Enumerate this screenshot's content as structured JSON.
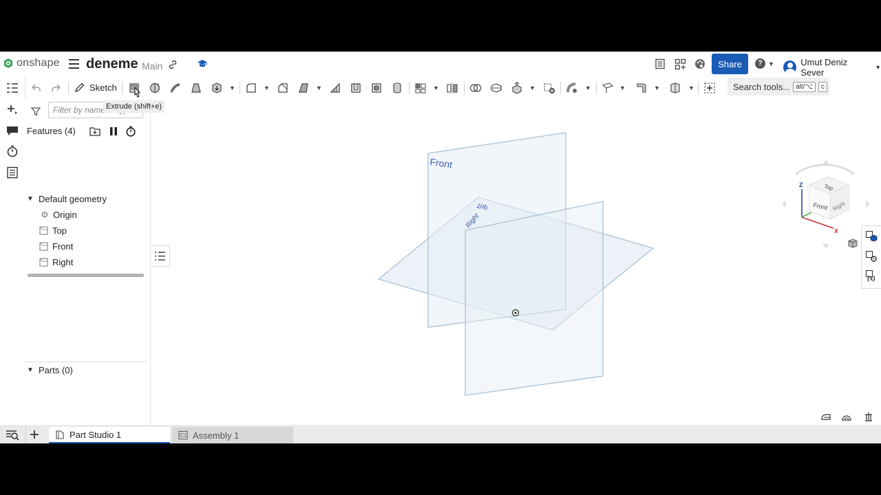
{
  "header": {
    "logo_text": "onshape",
    "doc_name": "deneme",
    "branch": "Main",
    "share_label": "Share",
    "help_label": "?",
    "user_name": "Umut Deniz Sever"
  },
  "toolbar": {
    "sketch_label": "Sketch",
    "search_label": "Search tools...",
    "search_key_1": "alt/⌥",
    "search_key_2": "c",
    "tooltip": "Extrude (shift+e)"
  },
  "panel": {
    "filter_placeholder": "Filter by name or type",
    "features_title": "Features (4)",
    "default_geometry": "Default geometry",
    "items": [
      {
        "label": "Origin"
      },
      {
        "label": "Top"
      },
      {
        "label": "Front"
      },
      {
        "label": "Right"
      }
    ],
    "parts_title": "Parts (0)"
  },
  "viewport": {
    "plane_labels": {
      "front": "Front",
      "top": "Top",
      "right": "Right"
    },
    "view_cube": {
      "top": "Top",
      "front": "Front",
      "right": "Right",
      "axis_x": "X",
      "axis_z": "Z"
    }
  },
  "tabs": [
    {
      "label": "Part Studio 1",
      "active": true
    },
    {
      "label": "Assembly 1",
      "active": false
    }
  ],
  "colors": {
    "accent": "#1a5bb5",
    "plane_fill": "#e7eef5",
    "plane_stroke": "#a9c1d6",
    "plane_label": "#3b5fa8"
  }
}
